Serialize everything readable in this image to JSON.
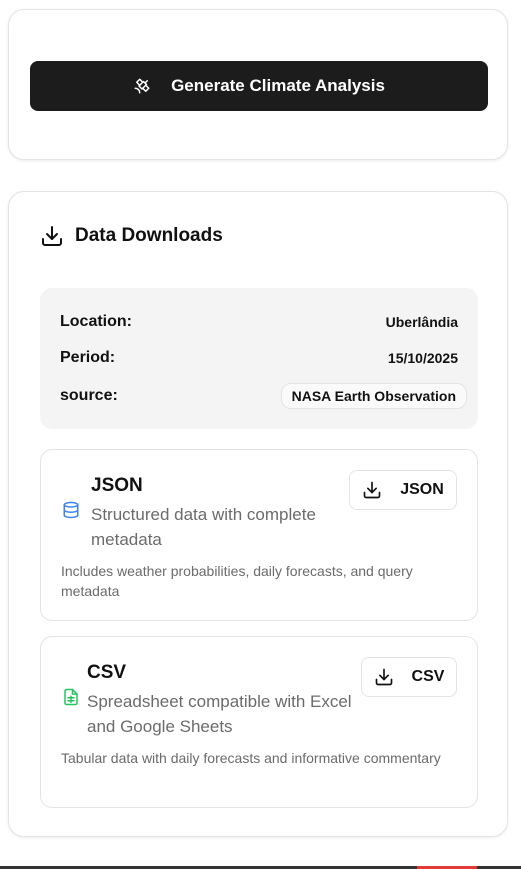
{
  "generate": {
    "label": "Generate Climate Analysis",
    "icon": "satellite-icon"
  },
  "downloads": {
    "title": "Data Downloads",
    "icon": "download-icon",
    "meta": {
      "location_label": "Location:",
      "location_value": "Uberlândia",
      "period_label": "Period:",
      "period_value": "15/10/2025",
      "source_label": "source:",
      "source_value": "NASA Earth Observation"
    },
    "formats": [
      {
        "name": "JSON",
        "icon": "database-icon",
        "icon_color": "#3b82f6",
        "description": "Structured data with complete metadata",
        "note": "Includes weather probabilities, daily forecasts, and query metadata",
        "button_label": "JSON"
      },
      {
        "name": "CSV",
        "icon": "spreadsheet-file-icon",
        "icon_color": "#22c55e",
        "description": "Spreadsheet compatible with Excel and Google Sheets",
        "note": "Tabular data with daily forecasts and informative commentary",
        "button_label": "CSV"
      }
    ]
  }
}
